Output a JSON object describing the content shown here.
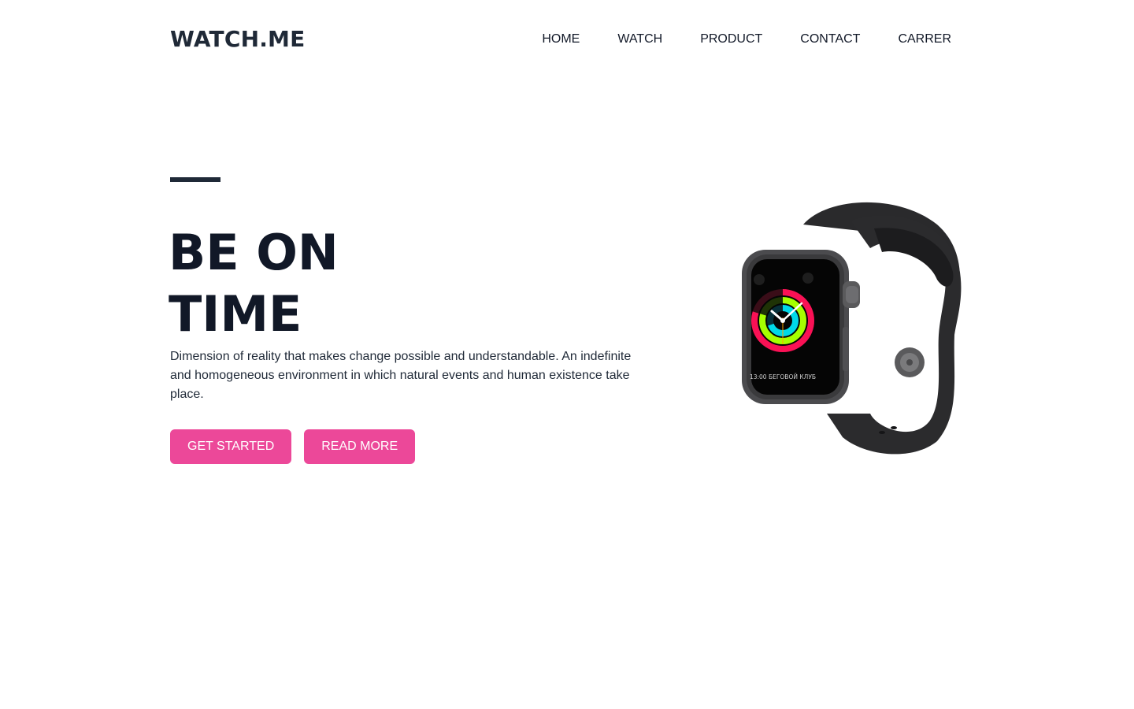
{
  "header": {
    "logo": "WATCH.ME",
    "nav": [
      {
        "label": "HOME"
      },
      {
        "label": "WATCH"
      },
      {
        "label": "PRODUCT"
      },
      {
        "label": "CONTACT"
      },
      {
        "label": "CARRER"
      }
    ]
  },
  "hero": {
    "headline_line1": "BE ON",
    "headline_line2": "TIME",
    "description": "Dimension of reality that makes change possible and understandable. An indefinite and homogeneous environment in which natural events and human existence take place.",
    "primary_button": "GET STARTED",
    "secondary_button": "READ MORE"
  },
  "product_image": {
    "watch_screen_text": "13:00 БЕГОВОЙ КЛУБ"
  },
  "colors": {
    "accent": "#ec4899",
    "text_dark": "#111827"
  }
}
